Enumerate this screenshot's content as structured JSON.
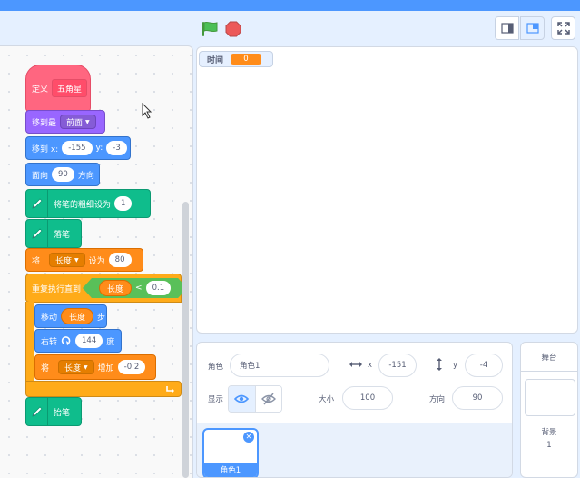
{
  "code": {
    "define_label": "定义",
    "define_name": "五角星",
    "goto_front": {
      "label": "移到最",
      "option": "前面"
    },
    "goto_xy": {
      "label": "移到 x:",
      "x": "-155",
      "y_label": "y:",
      "y": "-3"
    },
    "point_direction": {
      "label": "面向",
      "value": "90",
      "suffix": "方向"
    },
    "set_pen_size": {
      "label": "将笔的粗细设为",
      "value": "1"
    },
    "pen_down": {
      "label": "落笔"
    },
    "set_var": {
      "label": "将",
      "var": "长度",
      "to": "设为",
      "value": "80"
    },
    "repeat_until": {
      "label": "重复执行直到",
      "var": "长度",
      "op": "<",
      "value": "0.1"
    },
    "move": {
      "label": "移动",
      "var": "长度",
      "suffix": "步"
    },
    "turn_right": {
      "label": "右转",
      "value": "144",
      "suffix": "度"
    },
    "change_var": {
      "label": "将",
      "var": "长度",
      "by": "增加",
      "value": "-0.2"
    },
    "pen_up": {
      "label": "抬笔"
    }
  },
  "stage": {
    "monitor_label": "时间",
    "monitor_value": "0"
  },
  "sprite_info": {
    "sprite_label": "角色",
    "sprite_name": "角色1",
    "x_label": "x",
    "x": "-151",
    "y_label": "y",
    "y": "-4",
    "show_label": "显示",
    "size_label": "大小",
    "size": "100",
    "direction_label": "方向",
    "direction": "90"
  },
  "sprite_list": {
    "items": [
      {
        "name": "角色1"
      }
    ]
  },
  "stage_panel": {
    "title": "舞台",
    "backdrop_label": "背景",
    "backdrop_count": "1"
  },
  "colors": {
    "motion": "#4c97ff",
    "looks": "#9966ff",
    "pen": "#0fbd8c",
    "variables": "#ff8c1a",
    "control": "#ffab19",
    "my_blocks": "#ff6680",
    "operators": "#59c059"
  }
}
